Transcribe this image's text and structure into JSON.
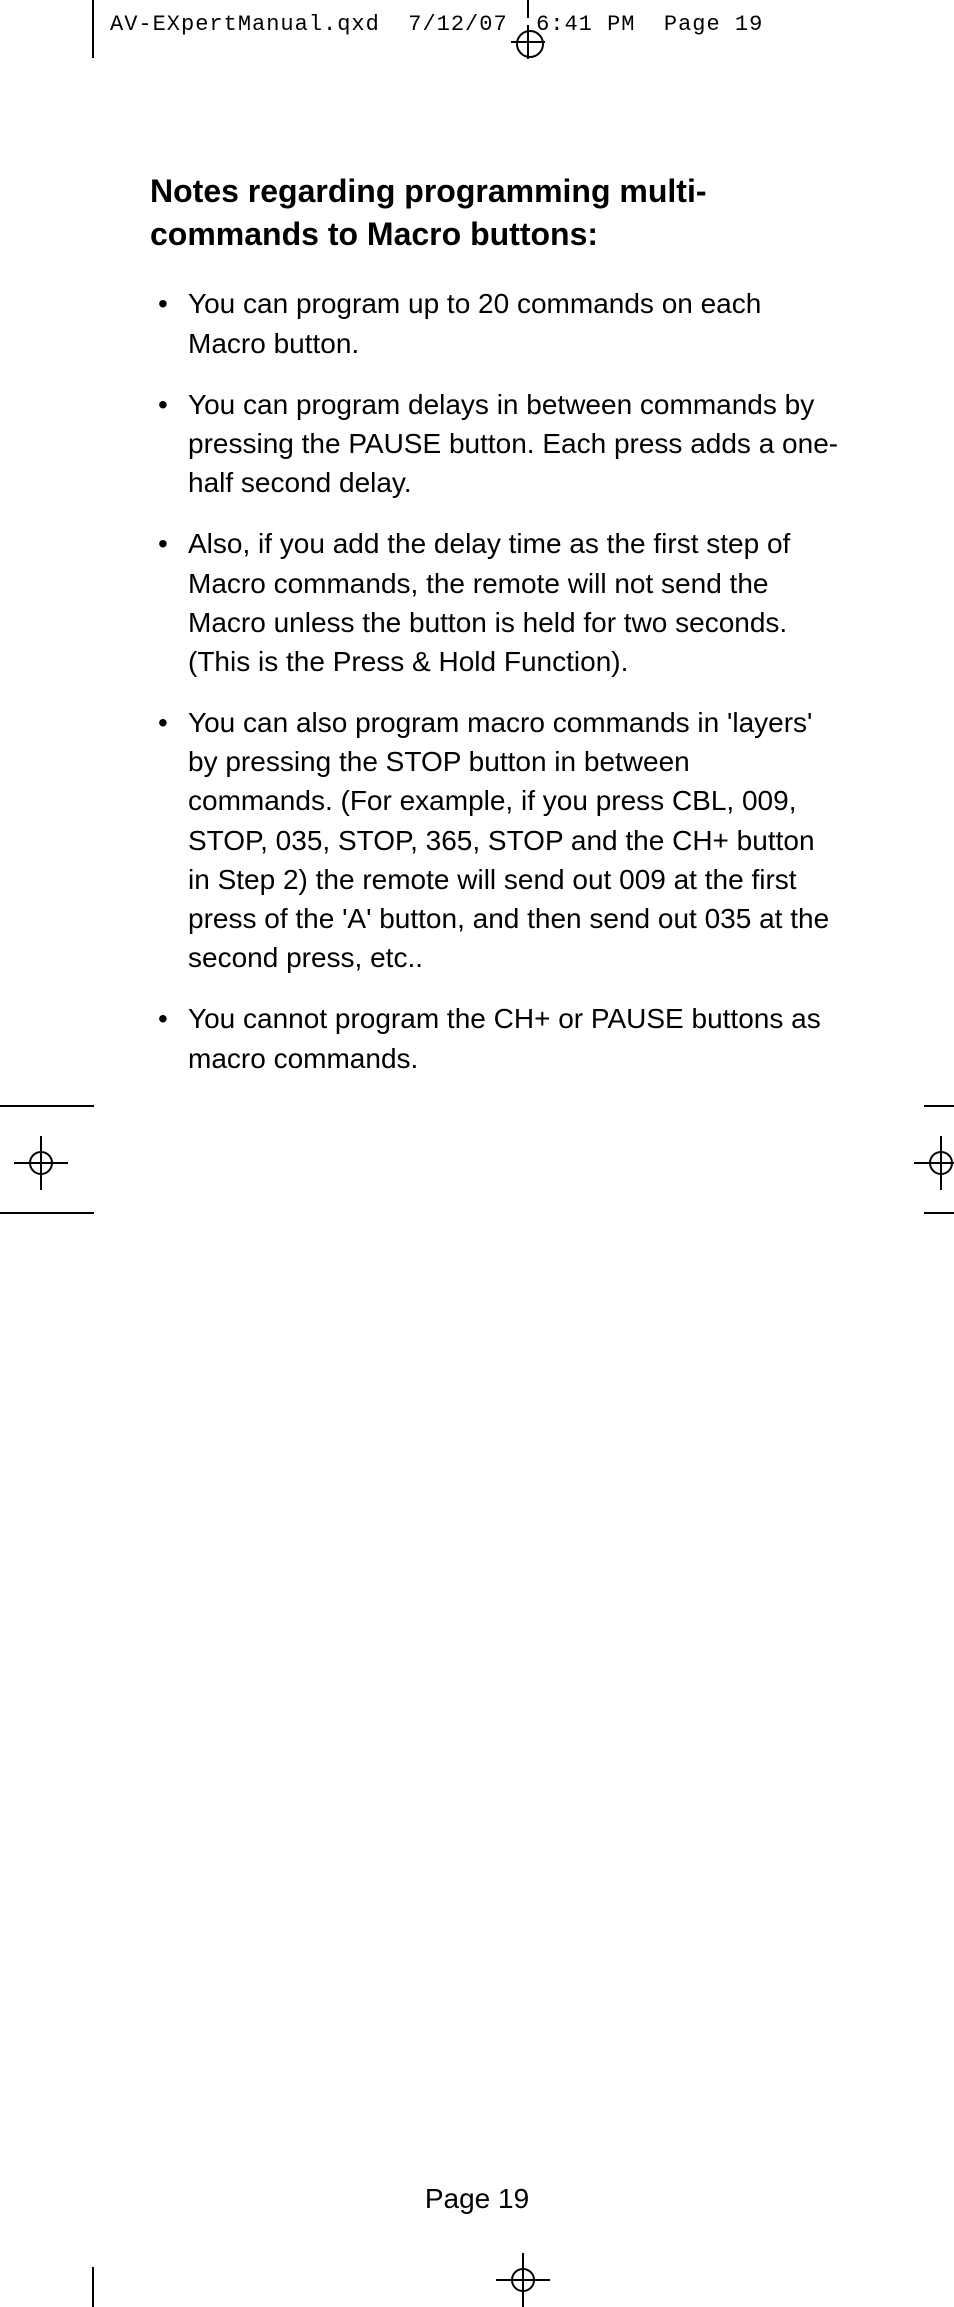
{
  "header": {
    "filename": "AV-EXpertManual.qxd",
    "date": "7/12/07",
    "time": "6:41 PM",
    "page_ref": "Page 19"
  },
  "content": {
    "title": "Notes regarding programming multi-commands to Macro buttons:",
    "bullets": [
      "You can program up to 20 commands on each Macro button.",
      "You can program delays in between commands by pressing the PAUSE button. Each press adds a one-half second delay.",
      "Also, if you add the delay time as the first step of Macro commands, the remote will not send the Macro unless the button is held for two seconds. (This is the Press & Hold Function).",
      "You can also program macro commands in 'layers' by pressing the STOP button in between commands. (For example, if you press CBL, 009, STOP, 035, STOP, 365, STOP and the CH+ button in Step 2) the remote will send out 009 at the first press of the 'A' button, and then send out 035 at the second press, etc..",
      "You cannot program the CH+ or PAUSE buttons as macro commands."
    ]
  },
  "footer": {
    "page_label": "Page 19"
  }
}
